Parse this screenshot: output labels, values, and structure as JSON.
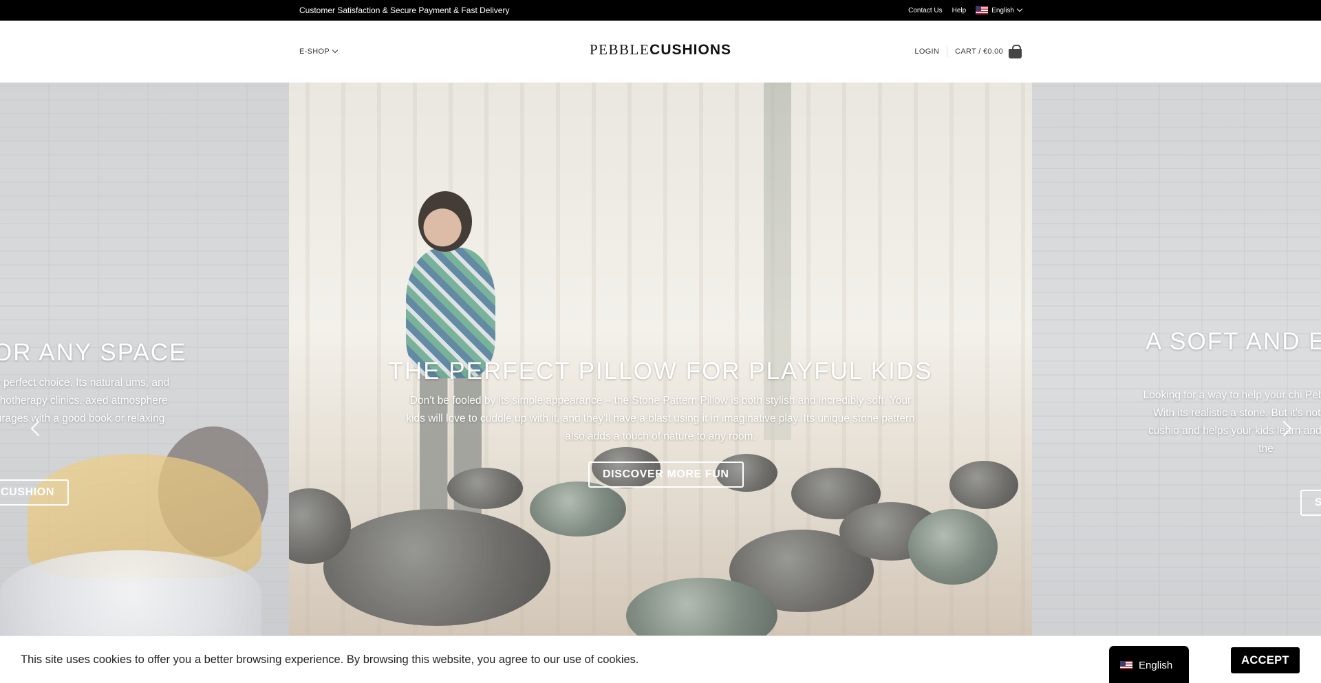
{
  "topbar": {
    "promo": "Customer Satisfaction & Secure Payment & Fast Delivery",
    "contact": "Contact Us",
    "help": "Help",
    "language": "English",
    "background": "#000000"
  },
  "header": {
    "menu_label": "E-SHOP",
    "logo_part1": "PEBBLE",
    "logo_part2": "CUSHIONS",
    "login": "LOGIN",
    "cart": "CART / €0.00"
  },
  "slider": {
    "slides": [
      {
        "title": "OR ANY SPACE",
        "text": "hion is the perfect choice. Its natural ums, and even psychotherapy clinics. axed atmosphere that encourages with a good book or relaxing after a",
        "button": "CUSHION"
      },
      {
        "title": "THE PERFECT PILLOW FOR PLAYFUL KIDS",
        "text": "Don't be fooled by its simple appearance – the Stone Pattern Pillow is both stylish and incredibly soft. Your kids will love to cuddle up with it, and they'll have a blast using it in imaginative play. Its unique stone pattern also adds a touch of nature to any room.",
        "button": "DISCOVER MORE FUN"
      },
      {
        "title": "A SOFT AND ED",
        "text": "Looking for a way to help your chi Pebble Cushions. With its realistic a stone. But it's not just a pretty cushio and helps your kids learn and grow around the",
        "button": "S"
      }
    ]
  },
  "cookie": {
    "text": "This site uses cookies to offer you a better browsing experience. By browsing this website, you agree to our use of cookies.",
    "language": "English",
    "accept": "ACCEPT"
  }
}
